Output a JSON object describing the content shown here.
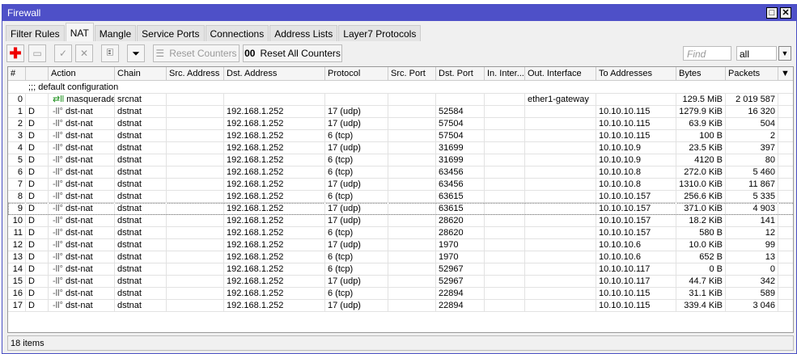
{
  "window": {
    "title": "Firewall",
    "maximize": "□",
    "close": "✕"
  },
  "tabs": [
    "Filter Rules",
    "NAT",
    "Mangle",
    "Service Ports",
    "Connections",
    "Address Lists",
    "Layer7 Protocols"
  ],
  "toolbar": {
    "reset_counters": "Reset Counters",
    "reset_all_counters": "Reset All Counters",
    "reset_all_icon_text": "00",
    "find_placeholder": "Find",
    "filter_value": "all"
  },
  "columns": [
    "#",
    "",
    "Action",
    "Chain",
    "Src. Address",
    "Dst. Address",
    "Protocol",
    "Src. Port",
    "Dst. Port",
    "In. Inter...",
    "Out. Interface",
    "To Addresses",
    "Bytes",
    "Packets"
  ],
  "comment": ";;; default configuration",
  "rows": [
    {
      "n": "0",
      "flag": "",
      "action": "masquerade",
      "chain": "srcnat",
      "src": "",
      "dst": "",
      "proto": "",
      "sport": "",
      "dport": "",
      "inif": "",
      "outif": "ether1-gateway",
      "to": "",
      "bytes": "129.5 MiB",
      "packets": "2 019 587"
    },
    {
      "n": "1",
      "flag": "D",
      "action": "dst-nat",
      "chain": "dstnat",
      "src": "",
      "dst": "192.168.1.252",
      "proto": "17 (udp)",
      "sport": "",
      "dport": "52584",
      "inif": "",
      "outif": "",
      "to": "10.10.10.115",
      "bytes": "1279.9 KiB",
      "packets": "16 320"
    },
    {
      "n": "2",
      "flag": "D",
      "action": "dst-nat",
      "chain": "dstnat",
      "src": "",
      "dst": "192.168.1.252",
      "proto": "17 (udp)",
      "sport": "",
      "dport": "57504",
      "inif": "",
      "outif": "",
      "to": "10.10.10.115",
      "bytes": "63.9 KiB",
      "packets": "504"
    },
    {
      "n": "3",
      "flag": "D",
      "action": "dst-nat",
      "chain": "dstnat",
      "src": "",
      "dst": "192.168.1.252",
      "proto": "6 (tcp)",
      "sport": "",
      "dport": "57504",
      "inif": "",
      "outif": "",
      "to": "10.10.10.115",
      "bytes": "100 B",
      "packets": "2"
    },
    {
      "n": "4",
      "flag": "D",
      "action": "dst-nat",
      "chain": "dstnat",
      "src": "",
      "dst": "192.168.1.252",
      "proto": "17 (udp)",
      "sport": "",
      "dport": "31699",
      "inif": "",
      "outif": "",
      "to": "10.10.10.9",
      "bytes": "23.5 KiB",
      "packets": "397"
    },
    {
      "n": "5",
      "flag": "D",
      "action": "dst-nat",
      "chain": "dstnat",
      "src": "",
      "dst": "192.168.1.252",
      "proto": "6 (tcp)",
      "sport": "",
      "dport": "31699",
      "inif": "",
      "outif": "",
      "to": "10.10.10.9",
      "bytes": "4120 B",
      "packets": "80"
    },
    {
      "n": "6",
      "flag": "D",
      "action": "dst-nat",
      "chain": "dstnat",
      "src": "",
      "dst": "192.168.1.252",
      "proto": "6 (tcp)",
      "sport": "",
      "dport": "63456",
      "inif": "",
      "outif": "",
      "to": "10.10.10.8",
      "bytes": "272.0 KiB",
      "packets": "5 460"
    },
    {
      "n": "7",
      "flag": "D",
      "action": "dst-nat",
      "chain": "dstnat",
      "src": "",
      "dst": "192.168.1.252",
      "proto": "17 (udp)",
      "sport": "",
      "dport": "63456",
      "inif": "",
      "outif": "",
      "to": "10.10.10.8",
      "bytes": "1310.0 KiB",
      "packets": "11 867"
    },
    {
      "n": "8",
      "flag": "D",
      "action": "dst-nat",
      "chain": "dstnat",
      "src": "",
      "dst": "192.168.1.252",
      "proto": "6 (tcp)",
      "sport": "",
      "dport": "63615",
      "inif": "",
      "outif": "",
      "to": "10.10.10.157",
      "bytes": "256.6 KiB",
      "packets": "5 335"
    },
    {
      "n": "9",
      "flag": "D",
      "action": "dst-nat",
      "chain": "dstnat",
      "src": "",
      "dst": "192.168.1.252",
      "proto": "17 (udp)",
      "sport": "",
      "dport": "63615",
      "inif": "",
      "outif": "",
      "to": "10.10.10.157",
      "bytes": "371.0 KiB",
      "packets": "4 903",
      "selected": true
    },
    {
      "n": "10",
      "flag": "D",
      "action": "dst-nat",
      "chain": "dstnat",
      "src": "",
      "dst": "192.168.1.252",
      "proto": "17 (udp)",
      "sport": "",
      "dport": "28620",
      "inif": "",
      "outif": "",
      "to": "10.10.10.157",
      "bytes": "18.2 KiB",
      "packets": "141"
    },
    {
      "n": "11",
      "flag": "D",
      "action": "dst-nat",
      "chain": "dstnat",
      "src": "",
      "dst": "192.168.1.252",
      "proto": "6 (tcp)",
      "sport": "",
      "dport": "28620",
      "inif": "",
      "outif": "",
      "to": "10.10.10.157",
      "bytes": "580 B",
      "packets": "12"
    },
    {
      "n": "12",
      "flag": "D",
      "action": "dst-nat",
      "chain": "dstnat",
      "src": "",
      "dst": "192.168.1.252",
      "proto": "17 (udp)",
      "sport": "",
      "dport": "1970",
      "inif": "",
      "outif": "",
      "to": "10.10.10.6",
      "bytes": "10.0 KiB",
      "packets": "99"
    },
    {
      "n": "13",
      "flag": "D",
      "action": "dst-nat",
      "chain": "dstnat",
      "src": "",
      "dst": "192.168.1.252",
      "proto": "6 (tcp)",
      "sport": "",
      "dport": "1970",
      "inif": "",
      "outif": "",
      "to": "10.10.10.6",
      "bytes": "652 B",
      "packets": "13"
    },
    {
      "n": "14",
      "flag": "D",
      "action": "dst-nat",
      "chain": "dstnat",
      "src": "",
      "dst": "192.168.1.252",
      "proto": "6 (tcp)",
      "sport": "",
      "dport": "52967",
      "inif": "",
      "outif": "",
      "to": "10.10.10.117",
      "bytes": "0 B",
      "packets": "0"
    },
    {
      "n": "15",
      "flag": "D",
      "action": "dst-nat",
      "chain": "dstnat",
      "src": "",
      "dst": "192.168.1.252",
      "proto": "17 (udp)",
      "sport": "",
      "dport": "52967",
      "inif": "",
      "outif": "",
      "to": "10.10.10.117",
      "bytes": "44.7 KiB",
      "packets": "342"
    },
    {
      "n": "16",
      "flag": "D",
      "action": "dst-nat",
      "chain": "dstnat",
      "src": "",
      "dst": "192.168.1.252",
      "proto": "6 (tcp)",
      "sport": "",
      "dport": "22894",
      "inif": "",
      "outif": "",
      "to": "10.10.10.115",
      "bytes": "31.1 KiB",
      "packets": "589"
    },
    {
      "n": "17",
      "flag": "D",
      "action": "dst-nat",
      "chain": "dstnat",
      "src": "",
      "dst": "192.168.1.252",
      "proto": "17 (udp)",
      "sport": "",
      "dport": "22894",
      "inif": "",
      "outif": "",
      "to": "10.10.10.115",
      "bytes": "339.4 KiB",
      "packets": "3 046"
    }
  ],
  "status": "18 items"
}
